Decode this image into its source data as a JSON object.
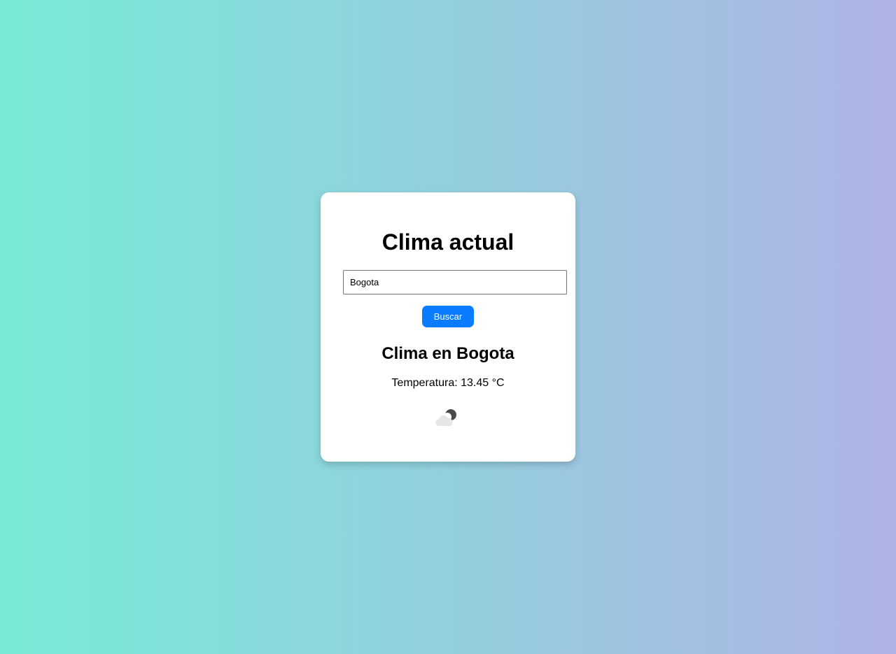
{
  "app": {
    "heading": "Clima actual"
  },
  "search": {
    "value": "Bogota",
    "button_label": "Buscar"
  },
  "result": {
    "title": "Clima en Bogota",
    "temperature_text": "Temperatura: 13.45 °C",
    "icon": "cloudy-night-icon"
  },
  "colors": {
    "background_start": "#77ebd6",
    "background_end": "#afb3e5",
    "button": "#0a7cff",
    "card": "#ffffff"
  }
}
